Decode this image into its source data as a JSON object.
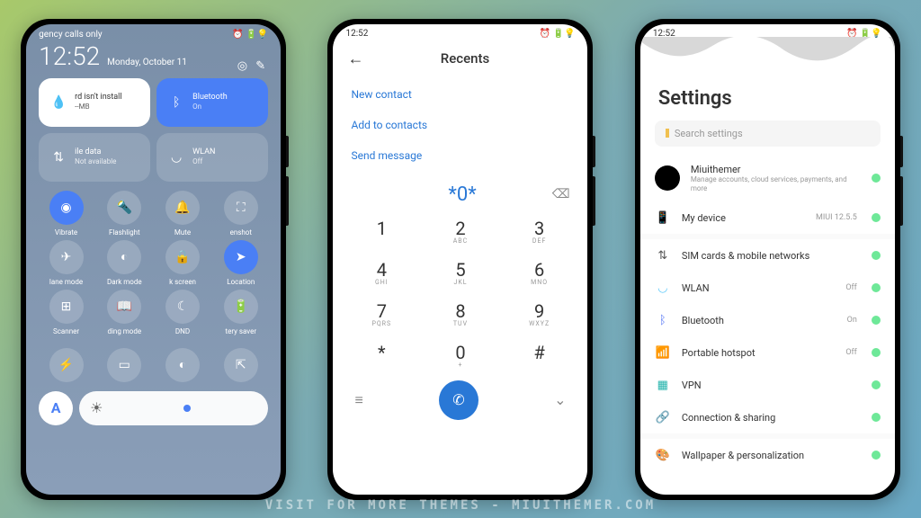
{
  "watermark": "VISIT FOR MORE THEMES - MIUITHEMER.COM",
  "phone1": {
    "carrier": "gency calls only",
    "status_icons": "⏰ 🔋💡",
    "time": "12:52",
    "date": "Monday, October 11",
    "cards": {
      "card1_title": "rd isn't install",
      "card1_sub": "--MB",
      "card2_title": "Bluetooth",
      "card2_sub": "On",
      "card3_title": "ile data",
      "card3_sub": "Not available",
      "card4_title": "WLAN",
      "card4_sub": "Off"
    },
    "toggles": [
      {
        "label": "Vibrate",
        "active": true
      },
      {
        "label": "Flashlight",
        "active": false
      },
      {
        "label": "Mute",
        "active": false
      },
      {
        "label": "enshot",
        "active": false
      },
      {
        "label": "lane mode",
        "active": false
      },
      {
        "label": "Dark mode",
        "active": false
      },
      {
        "label": "k screen",
        "active": false
      },
      {
        "label": "Location",
        "active": true
      },
      {
        "label": "Scanner",
        "active": false
      },
      {
        "label": "ding mode",
        "active": false
      },
      {
        "label": "DND",
        "active": false
      },
      {
        "label": "tery saver",
        "active": false
      }
    ],
    "letter": "A"
  },
  "phone2": {
    "time": "12:52",
    "status_icons": "⏰ 🔋💡",
    "title": "Recents",
    "actions": {
      "a1": "New contact",
      "a2": "Add to contacts",
      "a3": "Send message"
    },
    "input": "*0*",
    "keys": [
      {
        "n": "1",
        "s": ""
      },
      {
        "n": "2",
        "s": "ABC"
      },
      {
        "n": "3",
        "s": "DEF"
      },
      {
        "n": "4",
        "s": "GHI"
      },
      {
        "n": "5",
        "s": "JKL"
      },
      {
        "n": "6",
        "s": "MNO"
      },
      {
        "n": "7",
        "s": "PQRS"
      },
      {
        "n": "8",
        "s": "TUV"
      },
      {
        "n": "9",
        "s": "WXYZ"
      },
      {
        "n": "*",
        "s": ""
      },
      {
        "n": "0",
        "s": "+"
      },
      {
        "n": "#",
        "s": ""
      }
    ]
  },
  "phone3": {
    "time": "12:52",
    "status_icons": "⏰ 🔋💡",
    "title": "Settings",
    "search": "Search settings",
    "profile_name": "Miuithemer",
    "profile_desc": "Manage accounts, cloud services, payments, and more",
    "mydevice_label": "My device",
    "mydevice_value": "MIUI 12.5.5",
    "items": [
      {
        "label": "SIM cards & mobile networks",
        "value": ""
      },
      {
        "label": "WLAN",
        "value": "Off"
      },
      {
        "label": "Bluetooth",
        "value": "On"
      },
      {
        "label": "Portable hotspot",
        "value": "Off"
      },
      {
        "label": "VPN",
        "value": ""
      },
      {
        "label": "Connection & sharing",
        "value": ""
      }
    ],
    "wallpaper_label": "Wallpaper & personalization"
  }
}
